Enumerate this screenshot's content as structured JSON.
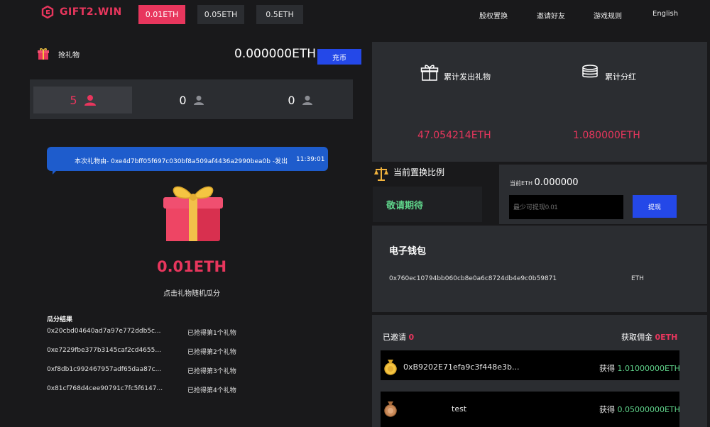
{
  "header": {
    "logo_text": "GIFT2.WIN",
    "tabs": [
      {
        "label": "0.01ETH",
        "active": true
      },
      {
        "label": "0.05ETH",
        "active": false
      },
      {
        "label": "0.5ETH",
        "active": false
      }
    ],
    "nav": [
      "股权置换",
      "邀请好友",
      "游戏规则",
      "English"
    ]
  },
  "left": {
    "grab_label": "抢礼物",
    "balance": "0.000000ETH",
    "charge_button": "充币",
    "counters": [
      "5",
      "0",
      "0"
    ],
    "bubble": {
      "message": "本次礼物由- 0xe4d7bff05f697c030bf8a509af4436a2990bea0b -发出",
      "time": "11:39:01"
    },
    "gift_amount": "0.01ETH",
    "gift_hint": "点击礼物随机瓜分",
    "results_title": "瓜分结果",
    "results": [
      {
        "address": "0x20cbd04640ad7a97e772ddb5c...",
        "rank": "已抢得第1个礼物"
      },
      {
        "address": "0xe7229fbe377b3145caf2cd4655...",
        "rank": "已抢得第2个礼物"
      },
      {
        "address": "0xf8db1c992467957adf65daa87c...",
        "rank": "已抢得第3个礼物"
      },
      {
        "address": "0x81cf768d4cee90791c7fc5f6147...",
        "rank": "已抢得第4个礼物"
      }
    ]
  },
  "stats": {
    "gifts_label": "累计发出礼物",
    "gifts_value": "47.054214ETH",
    "dividend_label": "累计分红",
    "dividend_value": "1.080000ETH"
  },
  "exchange": {
    "title": "当前置换比例",
    "pending": "敬请期待",
    "current_label": "当前ETH",
    "current_value": "0.000000",
    "withdraw_placeholder": "最少可提现0.01",
    "withdraw_button": "提现"
  },
  "wallet": {
    "title": "电子钱包",
    "address": "0x760ec10794bb060cb8e0a6c8724db4e9c0b59871",
    "currency": "ETH"
  },
  "invites": {
    "invited_label": "已邀请",
    "invited_count": "0",
    "commission_label": "获取佣金",
    "commission_value": "0ETH",
    "rows": [
      {
        "name": "0xB9202E71efa9c3f448e3b...",
        "gain_label": "获得",
        "gain_value": "1.01000000ETH",
        "medal": "gold"
      },
      {
        "name": "test",
        "gain_label": "获得",
        "gain_value": "0.05000000ETH",
        "medal": "bronze"
      }
    ]
  },
  "colors": {
    "accent": "#e8365d",
    "blue": "#2448e8",
    "green": "#5fd38a",
    "panel": "#2b2d31",
    "background": "#19191b"
  }
}
